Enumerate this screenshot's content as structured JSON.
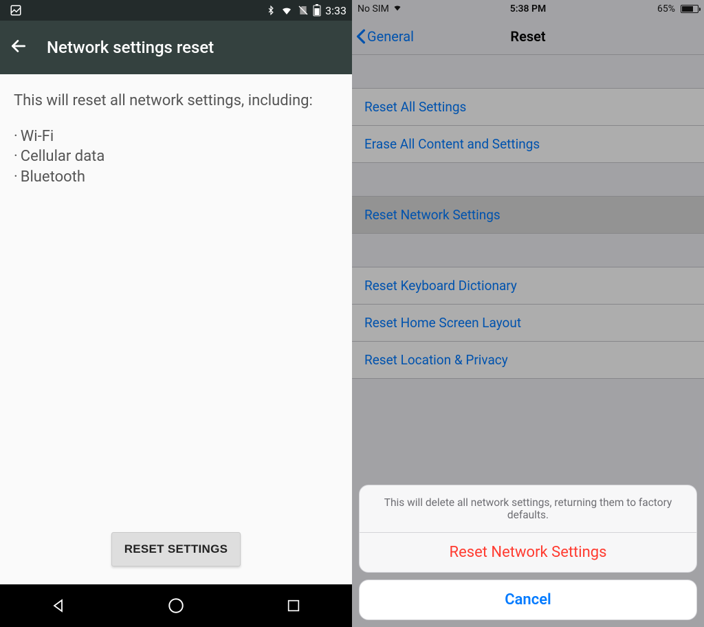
{
  "android": {
    "status": {
      "time": "3:33"
    },
    "title": "Network settings reset",
    "intro": "This will reset all network settings, including:",
    "bullets": [
      "Wi-Fi",
      "Cellular data",
      "Bluetooth"
    ],
    "reset_button": "RESET SETTINGS"
  },
  "ios": {
    "status": {
      "carrier": "No SIM",
      "time": "5:38 PM",
      "battery_pct": "65%"
    },
    "nav": {
      "back": "General",
      "title": "Reset"
    },
    "groups": [
      [
        "Reset All Settings",
        "Erase All Content and Settings"
      ],
      [
        "Reset Network Settings"
      ],
      [
        "Reset Keyboard Dictionary",
        "Reset Home Screen Layout",
        "Reset Location & Privacy"
      ]
    ],
    "selected_row": "Reset Network Settings",
    "sheet": {
      "message": "This will delete all network settings, returning them to factory defaults.",
      "destructive": "Reset Network Settings",
      "cancel": "Cancel"
    }
  }
}
